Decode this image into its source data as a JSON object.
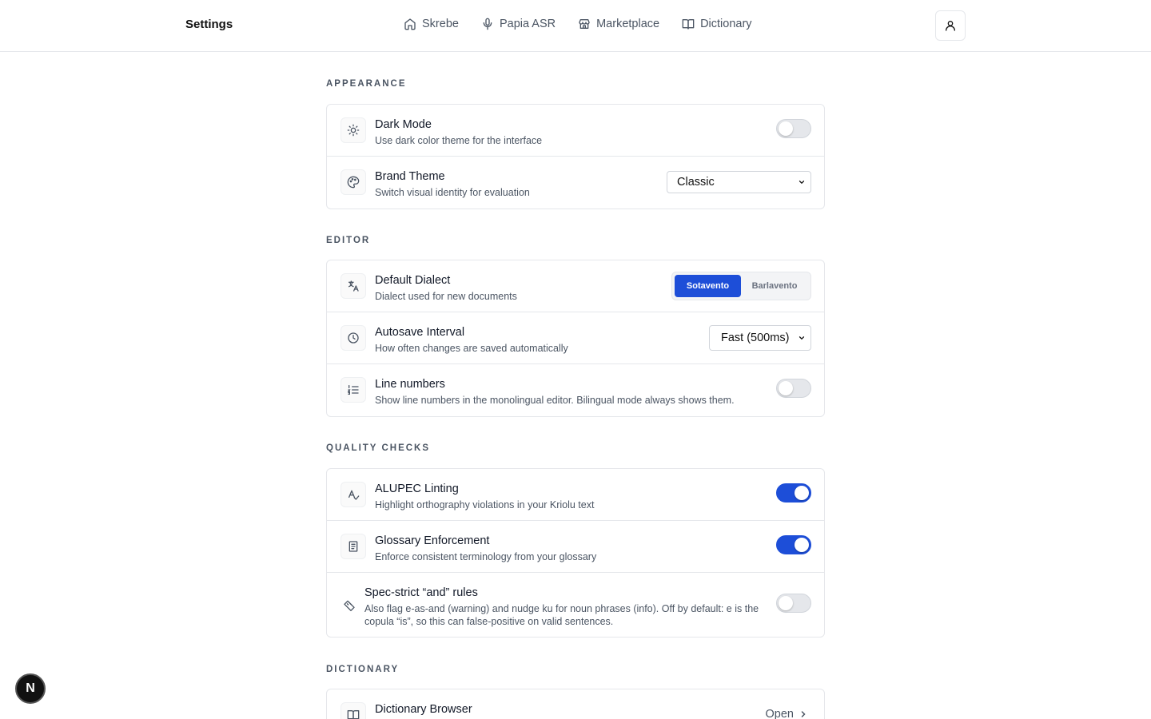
{
  "header": {
    "title": "Settings",
    "nav": [
      {
        "label": "Skrebe",
        "icon": "home-icon"
      },
      {
        "label": "Papia ASR",
        "icon": "microphone-icon"
      },
      {
        "label": "Marketplace",
        "icon": "store-icon"
      },
      {
        "label": "Dictionary",
        "icon": "book-icon"
      }
    ],
    "profile_icon": "user-icon"
  },
  "sections": {
    "appearance": {
      "title": "APPEARANCE",
      "dark_mode": {
        "title": "Dark Mode",
        "desc": "Use dark color theme for the interface",
        "enabled": false
      },
      "brand_theme": {
        "title": "Brand Theme",
        "desc": "Switch visual identity for evaluation",
        "value": "Classic"
      }
    },
    "editor": {
      "title": "EDITOR",
      "default_dialect": {
        "title": "Default Dialect",
        "desc": "Dialect used for new documents",
        "options": [
          "Sotavento",
          "Barlavento"
        ],
        "selected": "Sotavento"
      },
      "autosave": {
        "title": "Autosave Interval",
        "desc": "How often changes are saved automatically",
        "value": "Fast (500ms)"
      },
      "line_numbers": {
        "title": "Line numbers",
        "desc": "Show line numbers in the monolingual editor. Bilingual mode always shows them.",
        "enabled": false
      }
    },
    "quality": {
      "title": "QUALITY CHECKS",
      "alupec": {
        "title": "ALUPEC Linting",
        "desc": "Highlight orthography violations in your Kriolu text",
        "enabled": true
      },
      "glossary": {
        "title": "Glossary Enforcement",
        "desc": "Enforce consistent terminology from your glossary",
        "enabled": true
      },
      "spec_strict": {
        "title": "Spec-strict “and” rules",
        "desc": "Also flag e-as-and (warning) and nudge ku for noun phrases (info). Off by default: e is the copula “is”, so this can false-positive on valid sentences.",
        "enabled": false
      }
    },
    "dictionary": {
      "title": "DICTIONARY",
      "browser": {
        "title": "Dictionary Browser",
        "action": "Open"
      }
    }
  },
  "fab": {
    "label": "N"
  },
  "colors": {
    "accent": "#1d4ed8",
    "border": "#e5e7eb",
    "muted": "#4b5563"
  }
}
